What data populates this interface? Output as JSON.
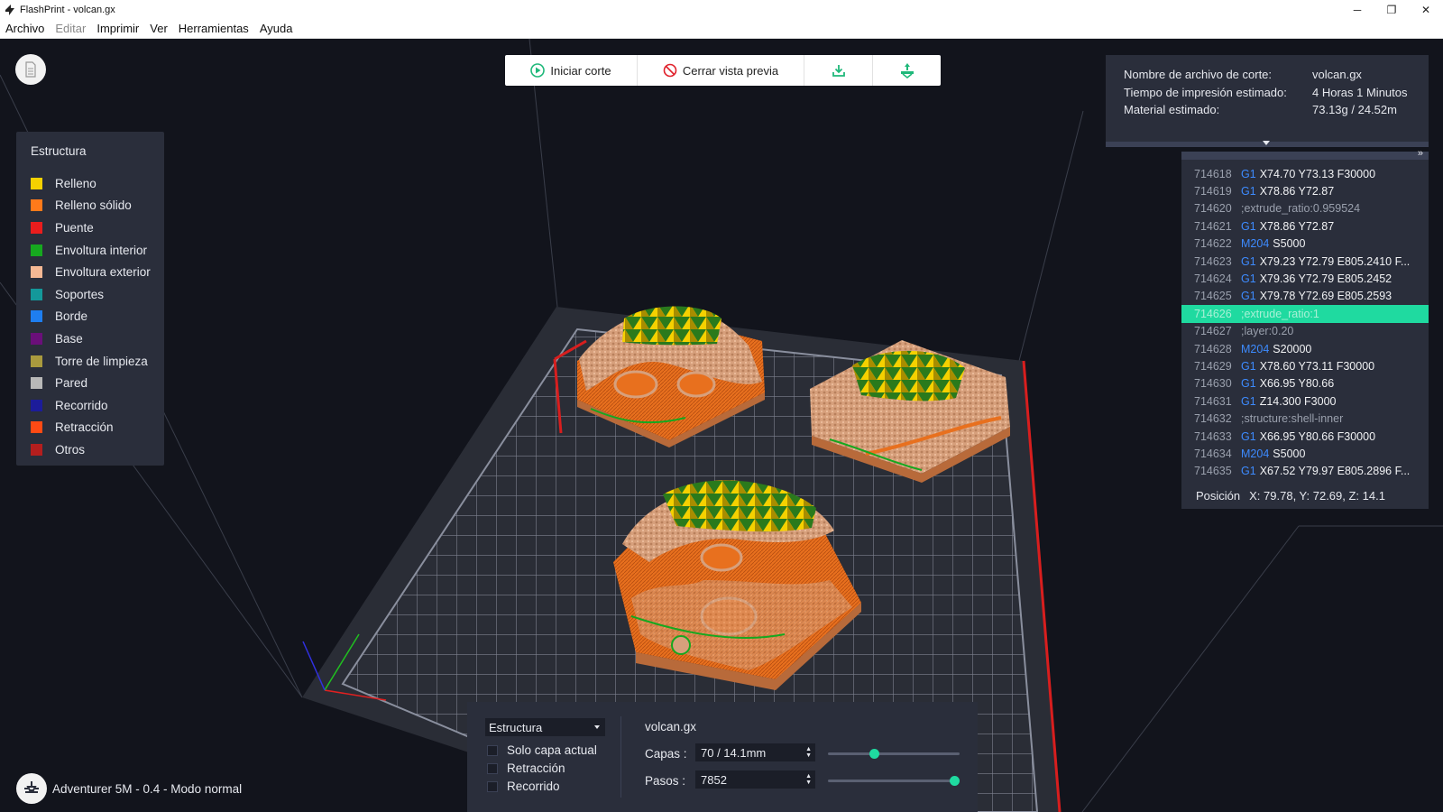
{
  "window": {
    "title": "FlashPrint - volcan.gx",
    "controls": {
      "minimize": "─",
      "maximize": "❐",
      "close": "✕"
    }
  },
  "menu": [
    {
      "label": "Archivo",
      "disabled": false
    },
    {
      "label": "Editar",
      "disabled": true
    },
    {
      "label": "Imprimir",
      "disabled": false
    },
    {
      "label": "Ver",
      "disabled": false
    },
    {
      "label": "Herramientas",
      "disabled": false
    },
    {
      "label": "Ayuda",
      "disabled": false
    }
  ],
  "toolbar": {
    "start_slice": "Iniciar corte",
    "close_preview": "Cerrar vista previa",
    "accent": "#1fb87a",
    "stop_color": "#e0202a"
  },
  "legend": {
    "title": "Estructura",
    "items": [
      {
        "label": "Relleno",
        "color": "#f5d100"
      },
      {
        "label": "Relleno sólido",
        "color": "#ff7a1a"
      },
      {
        "label": "Puente",
        "color": "#ea1d1d"
      },
      {
        "label": "Envoltura interior",
        "color": "#16a81f"
      },
      {
        "label": "Envoltura exterior",
        "color": "#f5b894"
      },
      {
        "label": "Soportes",
        "color": "#14989a"
      },
      {
        "label": "Borde",
        "color": "#1e7ef0"
      },
      {
        "label": "Base",
        "color": "#6a0f7a"
      },
      {
        "label": "Torre de limpieza",
        "color": "#a99a3e"
      },
      {
        "label": "Pared",
        "color": "#b8b8b8"
      },
      {
        "label": "Recorrido",
        "color": "#1c1c9a"
      },
      {
        "label": "Retracción",
        "color": "#ff4a14"
      },
      {
        "label": "Otros",
        "color": "#b41e1e"
      }
    ]
  },
  "info": {
    "rows": [
      {
        "label": "Nombre de archivo de corte:",
        "value": "volcan.gx"
      },
      {
        "label": "Tiempo de impresión estimado:",
        "value": "4 Horas 1 Minutos"
      },
      {
        "label": "Material estimado:",
        "value": "73.13g / 24.52m"
      }
    ]
  },
  "gcode": {
    "expand": "»",
    "lines": [
      {
        "num": "714618",
        "cmd": "G1",
        "args": "X74.70 Y73.13 F30000"
      },
      {
        "num": "714619",
        "cmd": "G1",
        "args": "X78.86 Y72.87"
      },
      {
        "num": "714620",
        "comment": ";extrude_ratio:0.959524"
      },
      {
        "num": "714621",
        "cmd": "G1",
        "args": "X78.86 Y72.87"
      },
      {
        "num": "714622",
        "cmd": "M204",
        "args": "S5000"
      },
      {
        "num": "714623",
        "cmd": "G1",
        "args": "X79.23 Y72.79 E805.2410 F..."
      },
      {
        "num": "714624",
        "cmd": "G1",
        "args": "X79.36 Y72.79 E805.2452"
      },
      {
        "num": "714625",
        "cmd": "G1",
        "args": "X79.78 Y72.69 E805.2593"
      },
      {
        "num": "714626",
        "comment": ";extrude_ratio:1",
        "selected": true
      },
      {
        "num": "714627",
        "comment": ";layer:0.20"
      },
      {
        "num": "714628",
        "cmd": "M204",
        "args": "S20000"
      },
      {
        "num": "714629",
        "cmd": "G1",
        "args": "X78.60 Y73.11 F30000"
      },
      {
        "num": "714630",
        "cmd": "G1",
        "args": "X66.95 Y80.66"
      },
      {
        "num": "714631",
        "cmd": "G1",
        "args": "Z14.300 F3000"
      },
      {
        "num": "714632",
        "comment": ";structure:shell-inner"
      },
      {
        "num": "714633",
        "cmd": "G1",
        "args": "X66.95 Y80.66 F30000"
      },
      {
        "num": "714634",
        "cmd": "M204",
        "args": "S5000"
      },
      {
        "num": "714635",
        "cmd": "G1",
        "args": "X67.52 Y79.97 E805.2896 F..."
      }
    ],
    "position_label": "Posición",
    "position_value": "X: 79.78, Y: 72.69, Z: 14.1"
  },
  "controls": {
    "view_mode": "Estructura",
    "checkboxes": [
      {
        "label": "Solo capa actual",
        "checked": false
      },
      {
        "label": "Retracción",
        "checked": false
      },
      {
        "label": "Recorrido",
        "checked": false
      }
    ],
    "filename": "volcan.gx",
    "layers_label": "Capas :",
    "layers_value": "70 / 14.1mm",
    "layers_fraction": 0.34,
    "steps_label": "Pasos :",
    "steps_value": "7852",
    "steps_fraction": 1.0
  },
  "printer": {
    "status": "Adventurer 5M - 0.4 - Modo normal"
  }
}
